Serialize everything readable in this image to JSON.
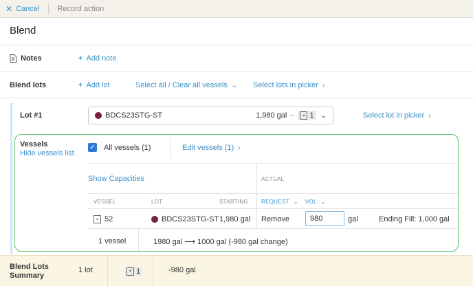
{
  "topbar": {
    "cancel_label": "Cancel",
    "record_action": "Record action"
  },
  "title": "Blend",
  "notes": {
    "label": "Notes",
    "add_note": "Add note"
  },
  "blend_lots": {
    "label": "Blend lots",
    "add_lot": "Add lot",
    "select_clear": "Select all / Clear all vessels",
    "select_picker": "Select lots in picker"
  },
  "lot": {
    "label": "Lot #1",
    "code": "BDCS23STG-ST",
    "volume": "1,980 gal",
    "dash": "–",
    "vessel_count": "1",
    "select_in_picker": "Select lot in picker",
    "dot_color": "#7a1f3d"
  },
  "vessels": {
    "label": "Vessels",
    "hide_list": "Hide vessels list",
    "all_vessels": "All vessels (1)",
    "edit_vessels": "Edit vessels (1)",
    "show_capacities": "Show Capacities",
    "actual": "ACTUAL",
    "headers": {
      "vessel": "VESSEL",
      "lot": "LOT",
      "starting": "STARTING",
      "request": "REQUEST",
      "vol": "VOL"
    },
    "row": {
      "vessel": "52",
      "lot": "BDCS23STG-ST",
      "starting": "1,980 gal",
      "request": "Remove",
      "vol": "980",
      "unit": "gal",
      "ending_fill": "Ending Fill: 1,000 gal"
    },
    "footer": {
      "count": "1 vessel",
      "from": "1980 gal",
      "arrow": "⟶",
      "to": "1000 gal (-980 gal change)"
    }
  },
  "summary": {
    "label": "Blend Lots Summary",
    "lots": "1 lot",
    "vessels": "1",
    "change": "-980 gal"
  },
  "colors": {
    "accent": "#3a8fc8",
    "highlight_border": "#5fbf6f",
    "checkbox": "#2c7ad6"
  }
}
